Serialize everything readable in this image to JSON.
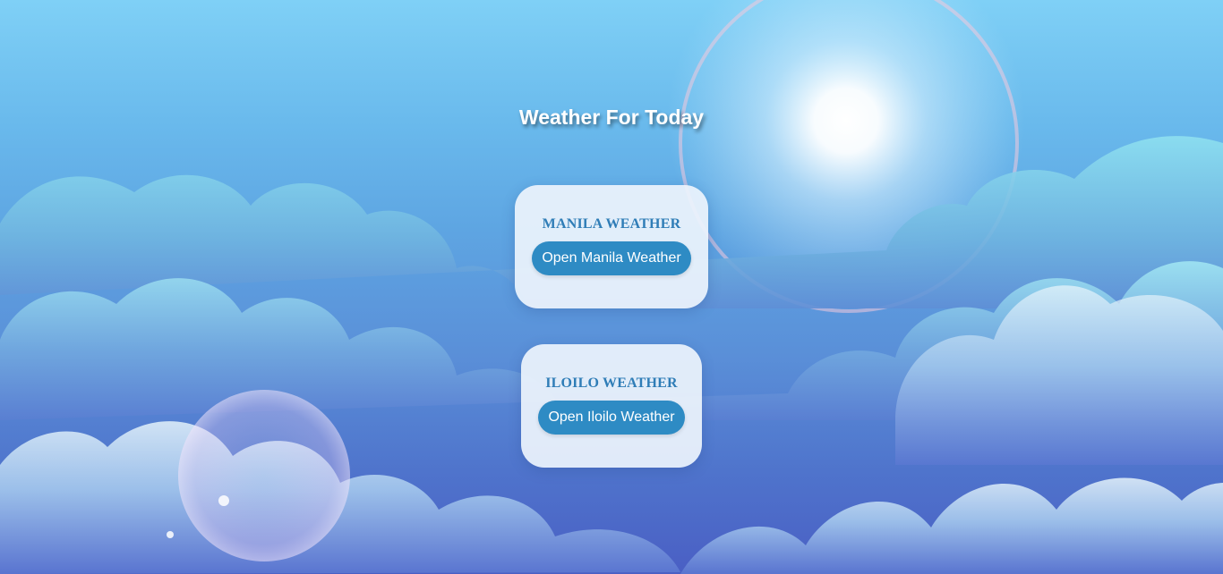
{
  "page": {
    "title": "Weather For Today"
  },
  "cards": [
    {
      "heading": "MANILA WEATHER",
      "button_label": "Open Manila Weather"
    },
    {
      "heading": "ILOILO WEATHER",
      "button_label": "Open Iloilo Weather"
    }
  ],
  "theme": {
    "sky_top": "#7fd0f6",
    "sky_bottom": "#4a5fc4",
    "card_heading_color": "#2f7db7",
    "button_color": "#2e8bc4",
    "button_text_color": "#ffffff"
  }
}
